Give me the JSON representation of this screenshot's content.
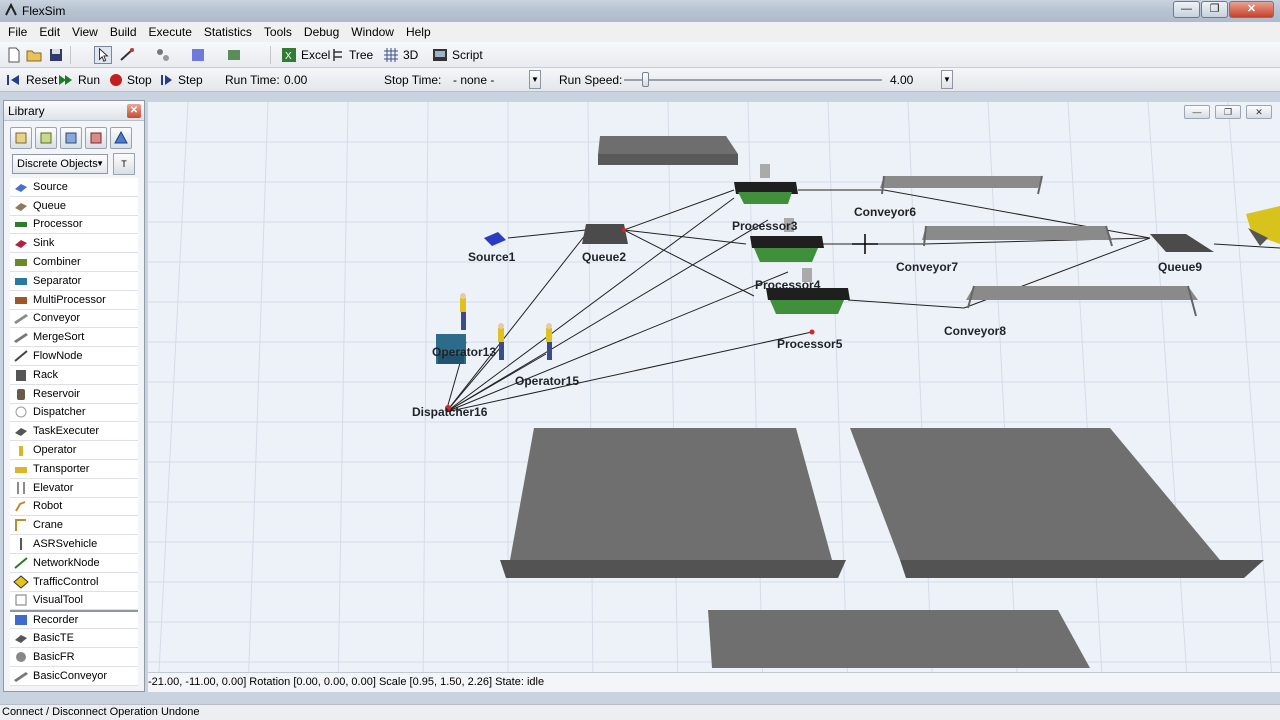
{
  "window": {
    "title": "FlexSim"
  },
  "menu": [
    "File",
    "Edit",
    "View",
    "Build",
    "Execute",
    "Statistics",
    "Tools",
    "Debug",
    "Window",
    "Help"
  ],
  "toolbar": {
    "excel": "Excel",
    "tree": "Tree",
    "three_d": "3D",
    "script": "Script"
  },
  "runbar": {
    "reset": "Reset",
    "run": "Run",
    "stop": "Stop",
    "step": "Step",
    "run_time_label": "Run Time:",
    "run_time_value": "0.00",
    "stop_time_label": "Stop Time:",
    "stop_time_value": "- none -",
    "run_speed_label": "Run Speed:",
    "run_speed_value": "4.00"
  },
  "library": {
    "title": "Library",
    "category": "Discrete Objects",
    "items": [
      "Source",
      "Queue",
      "Processor",
      "Sink",
      "Combiner",
      "Separator",
      "MultiProcessor",
      "Conveyor",
      "MergeSort",
      "FlowNode",
      "Rack",
      "Reservoir",
      "Dispatcher",
      "TaskExecuter",
      "Operator",
      "Transporter",
      "Elevator",
      "Robot",
      "Crane",
      "ASRSvehicle",
      "NetworkNode",
      "TrafficControl",
      "VisualTool",
      "Recorder",
      "BasicTE",
      "BasicFR",
      "BasicConveyor"
    ]
  },
  "model": {
    "labels": {
      "source1": "Source1",
      "queue2": "Queue2",
      "processor3": "Processor3",
      "processor4": "Processor4",
      "processor5": "Processor5",
      "conveyor6": "Conveyor6",
      "conveyor7": "Conveyor7",
      "conveyor8": "Conveyor8",
      "queue9": "Queue9",
      "operator13": "Operator13",
      "operator15": "Operator15",
      "dispatcher16": "Dispatcher16"
    }
  },
  "view_status": "-21.00, -11.00, 0.00]  Rotation [0.00, 0.00, 0.00]  Scale [0.95, 1.50, 2.26]  State: idle",
  "status": "Connect / Disconnect Operation Undone",
  "colors": {
    "floor": "#edf2f8",
    "grid": "#d6dee9",
    "slab": "#6e6e6e",
    "processor": "#3f8f3b"
  }
}
